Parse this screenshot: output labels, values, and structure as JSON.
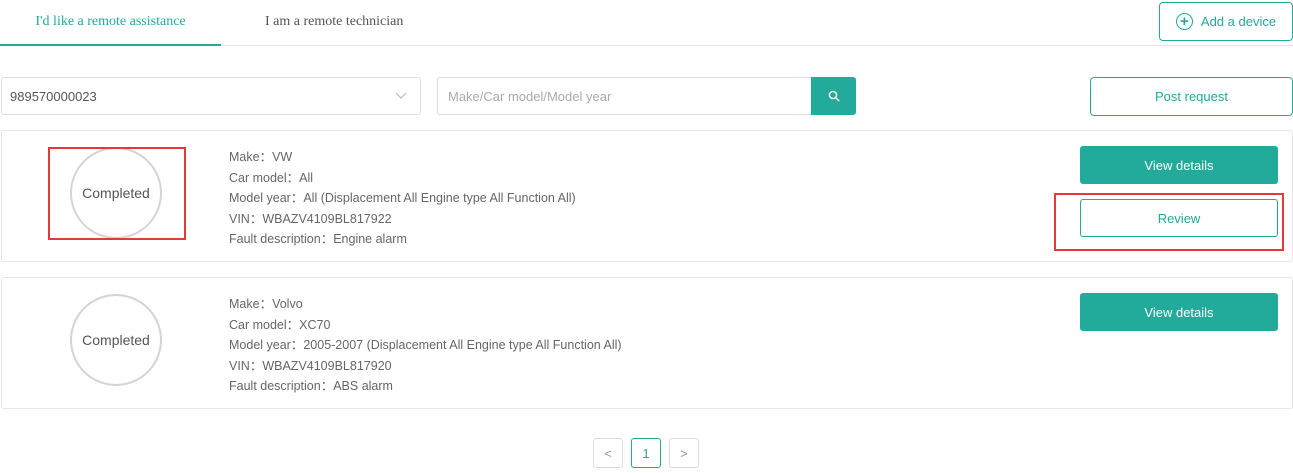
{
  "tabs": [
    {
      "label": "I'd like a remote assistance",
      "active": true
    },
    {
      "label": "I am a remote technician",
      "active": false
    }
  ],
  "add_device": {
    "label": "Add a device",
    "icon": "plus-circle-icon"
  },
  "filters": {
    "device_select_value": "989570000023",
    "search_placeholder": "Make/Car model/Model year",
    "search_icon": "search-icon",
    "post_request_label": "Post request"
  },
  "requests": [
    {
      "status": "Completed",
      "make": "Make：VW",
      "car_model": "Car model：All",
      "model_year": "Model year：All (Displacement All Engine type All Function All)",
      "vin": "VIN：WBAZV4109BL817922",
      "fault": "Fault description：Engine alarm",
      "view_details_label": "View details",
      "review_label": "Review"
    },
    {
      "status": "Completed",
      "make": "Make：Volvo",
      "car_model": "Car model：XC70",
      "model_year": "Model year：2005-2007 (Displacement All Engine type All Function All)",
      "vin": "VIN：WBAZV4109BL817920",
      "fault": "Fault description：ABS alarm",
      "view_details_label": "View details"
    }
  ],
  "pagination": {
    "prev": "<",
    "current_page": "1",
    "next": ">"
  },
  "colors": {
    "accent": "#22aa9b",
    "highlight": "#e53935",
    "border": "#e6e6e6"
  }
}
